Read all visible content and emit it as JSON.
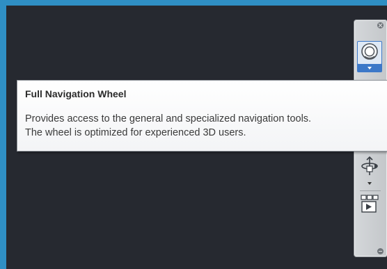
{
  "tooltip": {
    "title": "Full Navigation Wheel",
    "line1": "Provides access to the general and specialized navigation tools.",
    "line2": "The wheel is optimized for experienced 3D users."
  },
  "navbar": {
    "buttons": [
      {
        "icon": "full-navigation-wheel-icon",
        "active": true
      },
      {
        "icon": "orbit-icon",
        "active": false
      },
      {
        "icon": "showmotion-icon",
        "active": false
      }
    ]
  },
  "colors": {
    "desktop": "#2f8fc4",
    "viewport": "#262930",
    "navbar": "#cfd2d5",
    "active_highlight": "#3c78c8"
  }
}
